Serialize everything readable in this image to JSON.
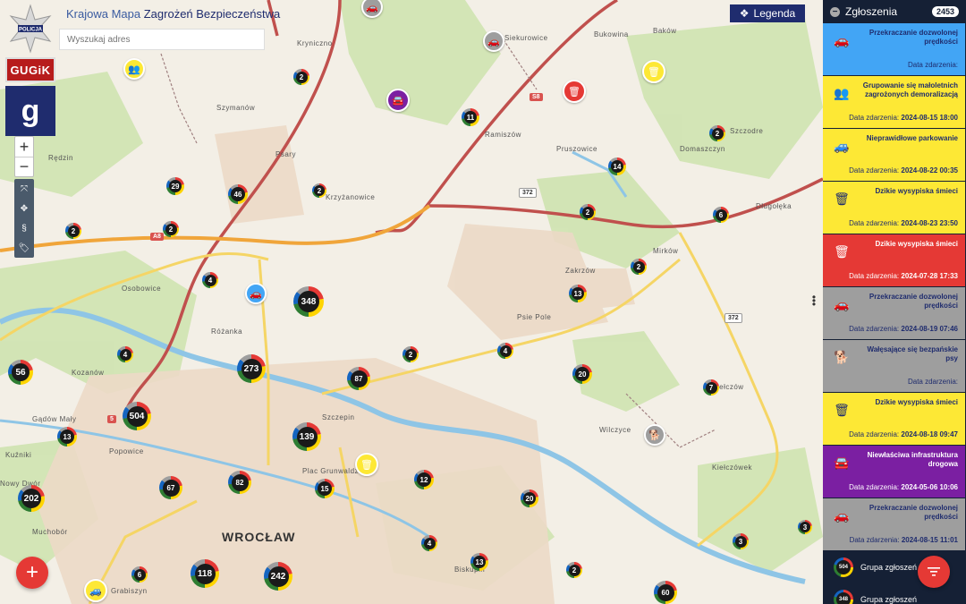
{
  "header": {
    "title_part1": "Krajowa Mapa",
    "title_part2": "Zagrożeń Bezpieczeństwa",
    "search_placeholder": "Wyszukaj adres",
    "logo_gugik": "GUGiK",
    "logo_policja": "POLICJA",
    "logo_g": "g"
  },
  "legend_button": {
    "label": "Legenda"
  },
  "zoom": {
    "in": "+",
    "out": "−"
  },
  "sidebar": {
    "title": "Zgłoszenia",
    "count": "2453",
    "date_label": "Data zdarzenia:",
    "cards": [
      {
        "name": "Przekraczanie dozwolonej prędkości",
        "date": "",
        "bg": "#42a5f5",
        "fg": "#1f2c6e",
        "icon": "car-speed-icon"
      },
      {
        "name": "Grupowanie się małoletnich zagrożonych demoralizacją",
        "date": "2024-08-15 18:00",
        "bg": "#fde835",
        "fg": "#1f2c6e",
        "icon": "group-icon"
      },
      {
        "name": "Nieprawidłowe parkowanie",
        "date": "2024-08-22 00:35",
        "bg": "#fde835",
        "fg": "#1f2c6e",
        "icon": "parking-car-icon"
      },
      {
        "name": "Dzikie wysypiska śmieci",
        "date": "2024-08-23 23:50",
        "bg": "#fde835",
        "fg": "#1f2c6e",
        "icon": "trash-icon"
      },
      {
        "name": "Dzikie wysypiska śmieci",
        "date": "2024-07-28 17:33",
        "bg": "#e53935",
        "fg": "#ffffff",
        "icon": "trash-icon"
      },
      {
        "name": "Przekraczanie dozwolonej prędkości",
        "date": "2024-08-19 07:46",
        "bg": "#9e9e9e",
        "fg": "#1f2c6e",
        "icon": "car-speed-icon"
      },
      {
        "name": "Wałęsające się bezpańskie psy",
        "date": "",
        "bg": "#9e9e9e",
        "fg": "#1f2c6e",
        "icon": "dog-icon"
      },
      {
        "name": "Dzikie wysypiska śmieci",
        "date": "2024-08-18 09:47",
        "bg": "#fde835",
        "fg": "#1f2c6e",
        "icon": "trash-icon"
      },
      {
        "name": "Niewłaściwa infrastruktura drogowa",
        "date": "2024-05-06 10:06",
        "bg": "#7b1fa2",
        "fg": "#ffffff",
        "icon": "road-car-icon"
      },
      {
        "name": "Przekraczanie dozwolonej prędkości",
        "date": "2024-08-15 11:01",
        "bg": "#9e9e9e",
        "fg": "#1f2c6e",
        "icon": "car-speed-icon"
      }
    ],
    "groups": [
      {
        "count": "504",
        "label": "Grupa zgłoszeń"
      },
      {
        "count": "348",
        "label": "Grupa zgłoszeń"
      }
    ]
  },
  "places": [
    {
      "name": "Kryniczno",
      "cls": ""
    },
    {
      "name": "Szymanów",
      "cls": ""
    },
    {
      "name": "Psary",
      "cls": ""
    },
    {
      "name": "Krzyżanowice",
      "cls": ""
    },
    {
      "name": "Ramiszów",
      "cls": ""
    },
    {
      "name": "Pruszowice",
      "cls": ""
    },
    {
      "name": "Domaszczyn",
      "cls": ""
    },
    {
      "name": "Szczodre",
      "cls": ""
    },
    {
      "name": "Długołęka",
      "cls": ""
    },
    {
      "name": "Mirków",
      "cls": ""
    },
    {
      "name": "Bukowina",
      "cls": ""
    },
    {
      "name": "Baków",
      "cls": ""
    },
    {
      "name": "Siekurowice",
      "cls": ""
    },
    {
      "name": "Rędzin",
      "cls": ""
    },
    {
      "name": "Osobowice",
      "cls": ""
    },
    {
      "name": "Różanka",
      "cls": ""
    },
    {
      "name": "Kozanów",
      "cls": ""
    },
    {
      "name": "Gądów Mały",
      "cls": ""
    },
    {
      "name": "Kuźniki",
      "cls": ""
    },
    {
      "name": "Nowy Dwór",
      "cls": ""
    },
    {
      "name": "Popowice",
      "cls": ""
    },
    {
      "name": "Szczepin",
      "cls": ""
    },
    {
      "name": "Plac Grunwaldzki",
      "cls": ""
    },
    {
      "name": "WROCŁAW",
      "cls": "city"
    },
    {
      "name": "Muchobór",
      "cls": ""
    },
    {
      "name": "Grabiszyn",
      "cls": ""
    },
    {
      "name": "Biskupin",
      "cls": ""
    },
    {
      "name": "Wilczyce",
      "cls": ""
    },
    {
      "name": "Kiełczów",
      "cls": ""
    },
    {
      "name": "Kiełczówek",
      "cls": ""
    },
    {
      "name": "Zakrzów",
      "cls": ""
    },
    {
      "name": "Psie Pole",
      "cls": ""
    }
  ],
  "road_shields": [
    {
      "label": "S8",
      "style": "red"
    },
    {
      "label": "372",
      "style": "white"
    },
    {
      "label": "A8",
      "style": "red"
    },
    {
      "label": "5",
      "style": "red"
    },
    {
      "label": "372",
      "style": "white"
    }
  ],
  "clusters": [
    {
      "count": "2"
    },
    {
      "count": "11"
    },
    {
      "count": "2"
    },
    {
      "count": "14"
    },
    {
      "count": "29"
    },
    {
      "count": "46"
    },
    {
      "count": "2"
    },
    {
      "count": "2"
    },
    {
      "count": "2"
    },
    {
      "count": "2"
    },
    {
      "count": "6"
    },
    {
      "count": "4"
    },
    {
      "count": "348"
    },
    {
      "count": "2"
    },
    {
      "count": "13"
    },
    {
      "count": "4"
    },
    {
      "count": "56"
    },
    {
      "count": "273"
    },
    {
      "count": "87"
    },
    {
      "count": "2"
    },
    {
      "count": "4"
    },
    {
      "count": "20"
    },
    {
      "count": "7"
    },
    {
      "count": "504"
    },
    {
      "count": "13"
    },
    {
      "count": "139"
    },
    {
      "count": "202"
    },
    {
      "count": "67"
    },
    {
      "count": "82"
    },
    {
      "count": "15"
    },
    {
      "count": "12"
    },
    {
      "count": "20"
    },
    {
      "count": "4"
    },
    {
      "count": "13"
    },
    {
      "count": "2"
    },
    {
      "count": "3"
    },
    {
      "count": "6"
    },
    {
      "count": "118"
    },
    {
      "count": "242"
    },
    {
      "count": "60"
    },
    {
      "count": "3"
    }
  ],
  "pins": [
    {
      "color": "#9e9e9e",
      "icon": "car-speed-icon",
      "glyph": "🚗"
    },
    {
      "color": "#9e9e9e",
      "icon": "car-speed-icon",
      "glyph": "🚗"
    },
    {
      "color": "#fde835",
      "icon": "group-icon",
      "glyph": "👥"
    },
    {
      "color": "#7b1fa2",
      "icon": "road-car-icon",
      "glyph": "🚘"
    },
    {
      "color": "#e53935",
      "icon": "trash-icon",
      "glyph": "🗑"
    },
    {
      "color": "#fde835",
      "icon": "trash-icon",
      "glyph": "🗑"
    },
    {
      "color": "#42a5f5",
      "icon": "car-speed-icon",
      "glyph": "🚗"
    },
    {
      "color": "#fde835",
      "icon": "trash-icon",
      "glyph": "🗑"
    },
    {
      "color": "#9e9e9e",
      "icon": "dog-icon",
      "glyph": "🐕"
    },
    {
      "color": "#fde835",
      "icon": "parking-car-icon",
      "glyph": "🚙"
    }
  ]
}
